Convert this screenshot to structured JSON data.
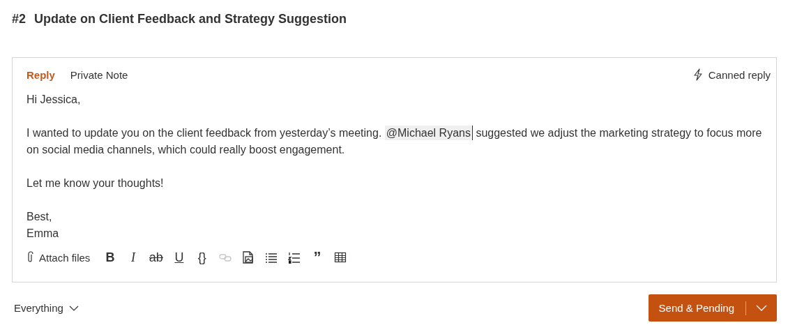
{
  "ticket": {
    "number": "#2",
    "title": "Update on Client Feedback and Strategy Suggestion"
  },
  "editor": {
    "tabs": [
      {
        "label": "Reply",
        "selected": true
      },
      {
        "label": "Private Note",
        "selected": false
      }
    ],
    "canned_reply": "Canned reply",
    "paragraphs": [
      {
        "kind": "plain",
        "lines": [
          "Hi Jessica,"
        ]
      },
      {
        "kind": "mention",
        "before": "I wanted to update you on the client feedback from yesterday’s meeting. ",
        "mention": "@Michael Ryans",
        "after": " suggested we adjust the marketing strategy to focus more on social media channels, which could really boost engagement."
      },
      {
        "kind": "plain",
        "lines": [
          "Let me know your thoughts!"
        ]
      },
      {
        "kind": "plain",
        "lines": [
          "Best,",
          "Emma"
        ]
      }
    ],
    "attach": "Attach files",
    "toolbar": [
      {
        "kind": "bold",
        "label": "B",
        "disabled": false
      },
      {
        "kind": "italic",
        "label": "I",
        "disabled": false
      },
      {
        "kind": "strike",
        "label": "ab",
        "disabled": false
      },
      {
        "kind": "underline",
        "label": "U",
        "disabled": false
      },
      {
        "kind": "code",
        "label": "{}",
        "disabled": false
      },
      {
        "kind": "link",
        "disabled": true
      },
      {
        "kind": "image",
        "disabled": false
      },
      {
        "kind": "bullets",
        "disabled": false
      },
      {
        "kind": "numbers",
        "disabled": false
      },
      {
        "kind": "quote",
        "label": "”",
        "disabled": false
      },
      {
        "kind": "table",
        "disabled": false
      }
    ]
  },
  "footer": {
    "filter": "Everything",
    "send": "Send & Pending"
  }
}
